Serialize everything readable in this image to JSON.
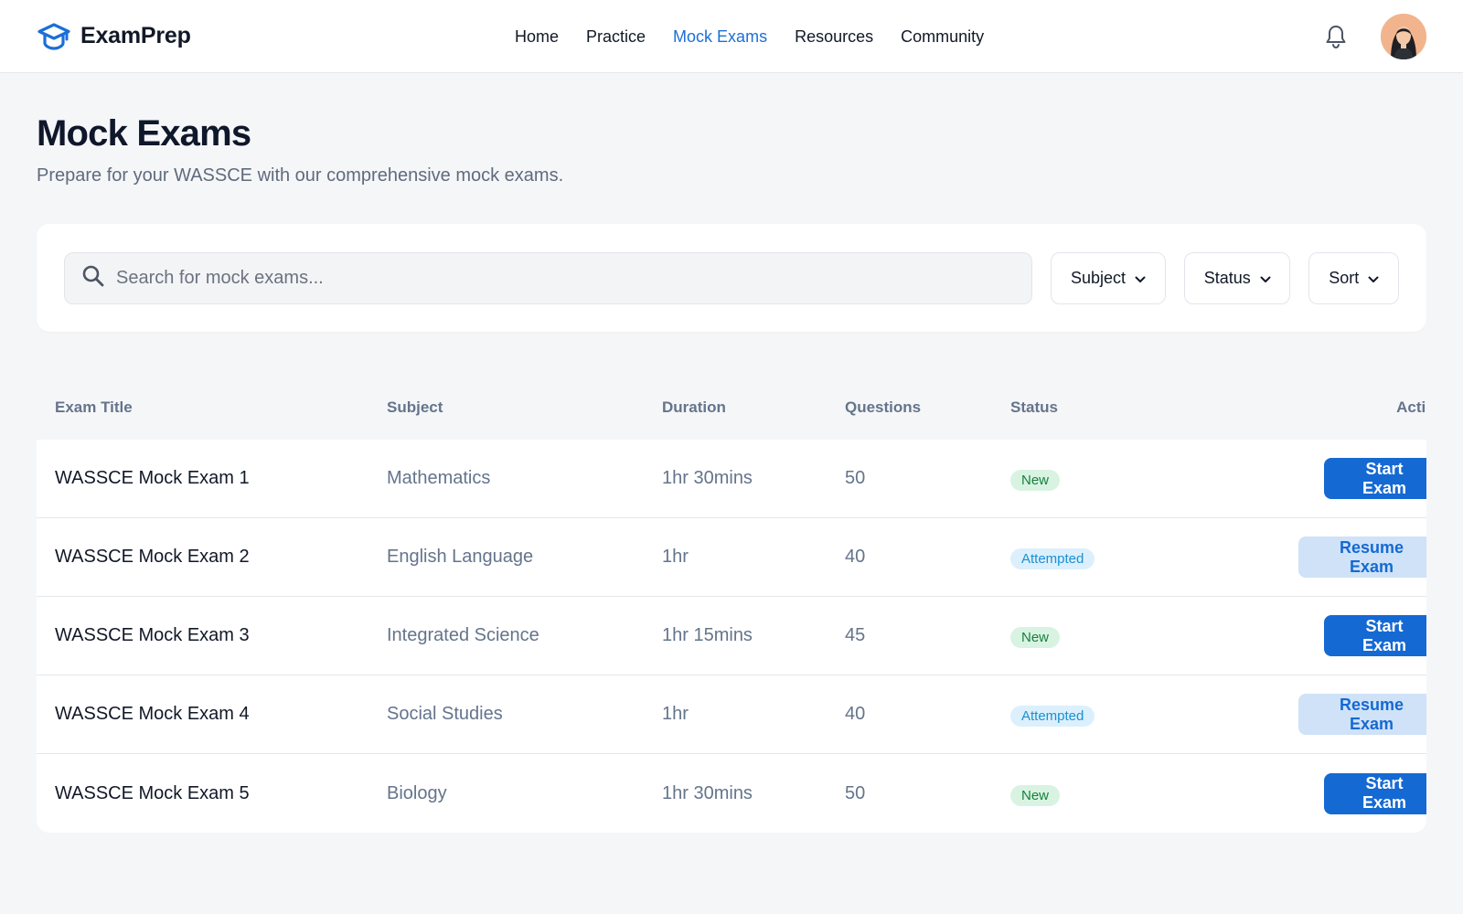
{
  "brand": {
    "name": "ExamPrep",
    "logo_icon": "graduation-cap-icon",
    "color": "#1d6fd6"
  },
  "nav": {
    "items": [
      {
        "label": "Home",
        "active": false
      },
      {
        "label": "Practice",
        "active": false
      },
      {
        "label": "Mock Exams",
        "active": true
      },
      {
        "label": "Resources",
        "active": false
      },
      {
        "label": "Community",
        "active": false
      }
    ]
  },
  "header_actions": {
    "notifications_icon": "bell-icon",
    "avatar_icon": "user-avatar"
  },
  "page": {
    "title": "Mock Exams",
    "subtitle": "Prepare for your WASSCE with our comprehensive mock exams."
  },
  "filters": {
    "search_placeholder": "Search for mock exams...",
    "search_value": "",
    "subject_label": "Subject",
    "status_label": "Status",
    "sort_label": "Sort"
  },
  "table": {
    "headers": {
      "title": "Exam Title",
      "subject": "Subject",
      "duration": "Duration",
      "questions": "Questions",
      "status": "Status",
      "action": "Action"
    },
    "rows": [
      {
        "title": "WASSCE Mock Exam 1",
        "subject": "Mathematics",
        "duration": "1hr 30mins",
        "questions": "50",
        "status": "New",
        "action": "Start Exam"
      },
      {
        "title": "WASSCE Mock Exam 2",
        "subject": "English Language",
        "duration": "1hr",
        "questions": "40",
        "status": "Attempted",
        "action": "Resume Exam"
      },
      {
        "title": "WASSCE Mock Exam 3",
        "subject": "Integrated Science",
        "duration": "1hr 15mins",
        "questions": "45",
        "status": "New",
        "action": "Start Exam"
      },
      {
        "title": "WASSCE Mock Exam 4",
        "subject": "Social Studies",
        "duration": "1hr",
        "questions": "40",
        "status": "Attempted",
        "action": "Resume Exam"
      },
      {
        "title": "WASSCE Mock Exam 5",
        "subject": "Biology",
        "duration": "1hr 30mins",
        "questions": "50",
        "status": "New",
        "action": "Start Exam"
      }
    ]
  },
  "colors": {
    "primary": "#1569d3",
    "status_new": "#16803c",
    "status_attempted": "#1b8fd2"
  }
}
